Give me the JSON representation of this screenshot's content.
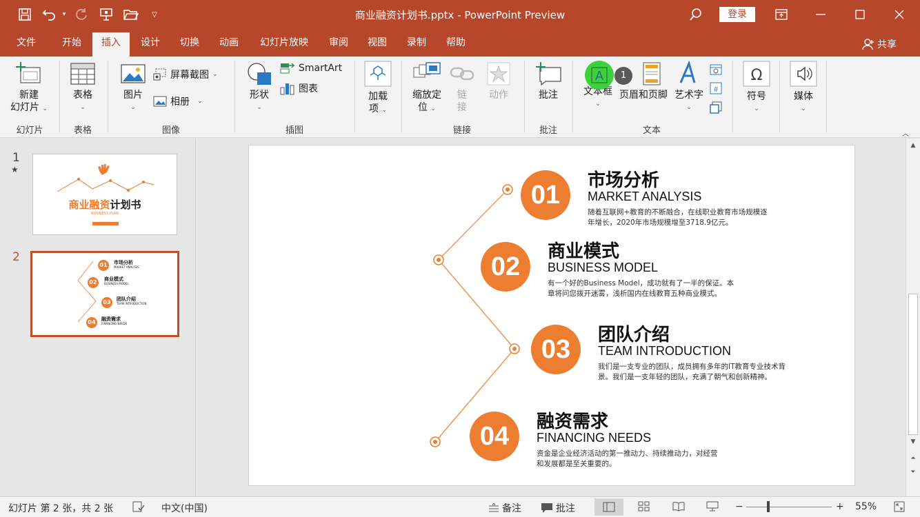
{
  "window": {
    "title": "商业融资计划书.pptx  -  PowerPoint Preview",
    "login_label": "登录"
  },
  "tabs": [
    "文件",
    "开始",
    "插入",
    "设计",
    "切换",
    "动画",
    "幻灯片放映",
    "审阅",
    "视图",
    "录制",
    "帮助"
  ],
  "active_tab": "插入",
  "share_label": "共享",
  "ribbon": {
    "new_slide": {
      "line1": "新建",
      "line2": "幻灯片"
    },
    "table": "表格",
    "picture": "图片",
    "screenshot": "屏幕截图",
    "album": "相册",
    "shapes": "形状",
    "smartart": "SmartArt",
    "chart": "图表",
    "addins": {
      "line1": "加载",
      "line2": "项"
    },
    "zoom": {
      "line1": "缩放定",
      "line2": "位"
    },
    "link": {
      "line1": "链",
      "line2": "接"
    },
    "action": "动作",
    "comment": "批注",
    "textbox": "文本框",
    "textbox_badge": "1",
    "header_footer": "页眉和页脚",
    "wordart": "艺术字",
    "symbol": "符号",
    "media": "媒体",
    "groups": {
      "slides": "幻灯片",
      "tables": "表格",
      "images": "图像",
      "illustrations": "插图",
      "links": "链接",
      "comments": "批注",
      "text": "文本"
    }
  },
  "thumbnails": [
    {
      "number": "1",
      "star": "★",
      "title_orange": "商业融资",
      "title_dark": "计划书",
      "subtitle": "BUSINESS PLAN"
    },
    {
      "number": "2",
      "items": [
        {
          "num": "01",
          "title": "市场分析",
          "sub": "MARKET ANALYSIS"
        },
        {
          "num": "02",
          "title": "商业模式",
          "sub": "BUSINESS MODEL"
        },
        {
          "num": "03",
          "title": "团队介绍",
          "sub": "TEAM INTRODUCTION"
        },
        {
          "num": "04",
          "title": "融资需求",
          "sub": "FINANCING NEEDS"
        }
      ]
    }
  ],
  "slide": {
    "items": [
      {
        "num": "01",
        "title": "市场分析",
        "subtitle": "MARKET ANALYSIS",
        "desc": [
          "随着互联网+教育的不断融合，在线职业教育市场规模逐",
          "年增长，2020年市场规模增至3718.9亿元。"
        ]
      },
      {
        "num": "02",
        "title": "商业模式",
        "subtitle": "BUSINESS MODEL",
        "desc": [
          "有一个好的Business Model，成功就有了一半的保证。本",
          "章将问您拨开迷雾，浅析国内在线教育五种商业模式。"
        ]
      },
      {
        "num": "03",
        "title": "团队介绍",
        "subtitle": "TEAM INTRODUCTION",
        "desc": [
          "我们是一支专业的团队，成员拥有多年的IT教育专业技术背",
          "景。我们是一支年轻的团队，充满了朝气和创新精神。"
        ]
      },
      {
        "num": "04",
        "title": "融资需求",
        "subtitle": "FINANCING NEEDS",
        "desc": [
          "资金是企业经济活动的第一推动力、持续推动力，对经营",
          "和发展都是至关重要的。"
        ]
      }
    ]
  },
  "status": {
    "slide_info": "幻灯片 第 2 张，共 2 张",
    "language": "中文(中国)",
    "notes": "备注",
    "comments": "批注",
    "zoom": "55%"
  },
  "colors": {
    "accent": "#b7472a",
    "orange": "#ed7d31"
  }
}
